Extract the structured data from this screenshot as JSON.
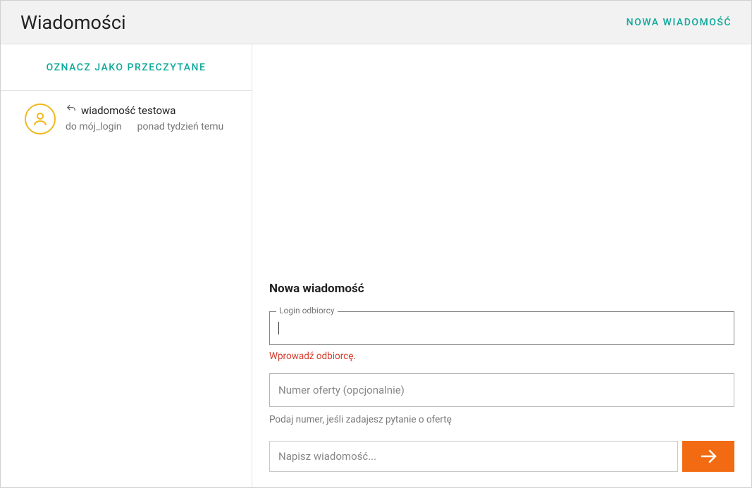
{
  "header": {
    "title": "Wiadomości",
    "new_message": "NOWA WIADOMOŚĆ"
  },
  "sidebar": {
    "mark_read": "OZNACZ JAKO PRZECZYTANE",
    "items": [
      {
        "subject": "wiadomość testowa",
        "to": "do mój_login",
        "time": "ponad tydzień temu"
      }
    ]
  },
  "compose": {
    "title": "Nowa wiadomość",
    "recipient_label": "Login odbiorcy",
    "recipient_value": "",
    "recipient_error": "Wprowadź odbiorcę.",
    "offer_placeholder": "Numer oferty (opcjonalnie)",
    "offer_helper": "Podaj numer, jeśli zadajesz pytanie o ofertę",
    "message_placeholder": "Napisz wiadomość..."
  }
}
